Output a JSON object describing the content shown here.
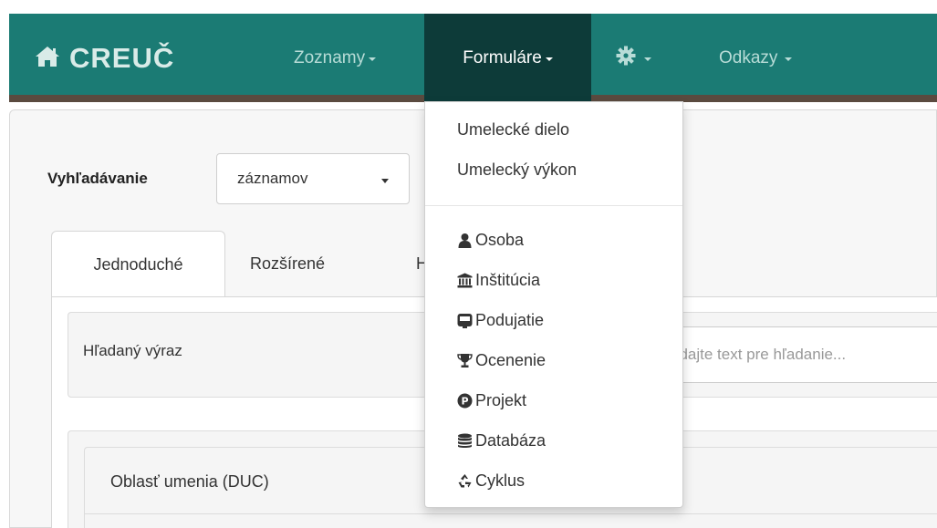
{
  "navbar": {
    "brand": "CREUČ",
    "items": [
      {
        "label": "Zoznamy"
      },
      {
        "label": "Formuláre"
      },
      {
        "label": ""
      },
      {
        "label": "Odkazy"
      }
    ]
  },
  "search": {
    "label": "Vyhľadávanie",
    "select_value": "záznamov"
  },
  "tabs": [
    {
      "label": "Jednoduché",
      "active": true
    },
    {
      "label": "Rozšírené"
    },
    {
      "label": "H"
    }
  ],
  "query": {
    "label": "Hľadaný výraz",
    "placeholder": "adajte text pre hľadanie..."
  },
  "section": {
    "title": "Oblasť umenia (DUC)"
  },
  "dropdown": {
    "group1": [
      "Umelecké dielo",
      "Umelecký výkon"
    ],
    "group2": [
      {
        "label": "Osoba",
        "icon": "user-icon"
      },
      {
        "label": "Inštitúcia",
        "icon": "institution-icon"
      },
      {
        "label": "Podujatie",
        "icon": "event-icon"
      },
      {
        "label": "Ocenenie",
        "icon": "trophy-icon"
      },
      {
        "label": "Projekt",
        "icon": "project-icon"
      },
      {
        "label": "Databáza",
        "icon": "database-icon"
      },
      {
        "label": "Cyklus",
        "icon": "recycle-icon"
      }
    ]
  },
  "colors": {
    "navbar": "#1b7b74",
    "navbar_active": "#0d3b39",
    "navbar_border": "#5a4a3f"
  }
}
